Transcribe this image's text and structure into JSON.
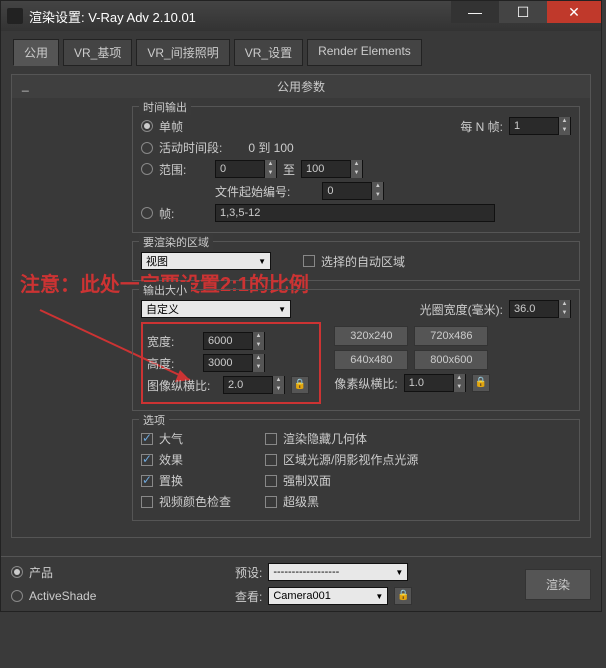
{
  "window": {
    "title": "渲染设置: V-Ray Adv 2.10.01"
  },
  "tabs": [
    "公用",
    "VR_基项",
    "VR_间接照明",
    "VR_设置",
    "Render Elements"
  ],
  "main_group": {
    "title": "公用参数",
    "collapse": "_"
  },
  "time_output": {
    "label": "时间输出",
    "single_frame": "单帧",
    "every_n": "每 N 帧:",
    "every_n_val": "1",
    "active_segment": "活动时间段:",
    "active_range": "0 到 100",
    "range": "范围:",
    "range_from": "0",
    "range_to_label": "至",
    "range_to": "100",
    "file_start": "文件起始编号:",
    "file_start_val": "0",
    "frames": "帧:",
    "frames_val": "1,3,5-12"
  },
  "render_area": {
    "label": "要渲染的区域",
    "dropdown": "视图",
    "auto": "选择的自动区域"
  },
  "annotation": "注意：此处一定要设置2:1的比例",
  "output_size": {
    "label": "输出大小",
    "custom": "自定义",
    "aperture": "光圈宽度(毫米):",
    "aperture_val": "36.0",
    "width": "宽度:",
    "width_val": "6000",
    "height": "高度:",
    "height_val": "3000",
    "presets": [
      "320x240",
      "720x486",
      "640x480",
      "800x600"
    ],
    "img_aspect": "图像纵横比:",
    "img_aspect_val": "2.0",
    "px_aspect": "像素纵横比:",
    "px_aspect_val": "1.0"
  },
  "options": {
    "label": "选项",
    "atmosphere": "大气",
    "render_hidden": "渲染隐藏几何体",
    "effects": "效果",
    "area_lights": "区域光源/阴影视作点光源",
    "displacement": "置换",
    "two_sided": "强制双面",
    "video_color": "视频颜色检查",
    "super_black": "超级黑"
  },
  "footer": {
    "product": "产品",
    "preset": "预设:",
    "activeshade": "ActiveShade",
    "viewport": "查看:",
    "viewport_val": "Camera001",
    "render": "渲染"
  }
}
